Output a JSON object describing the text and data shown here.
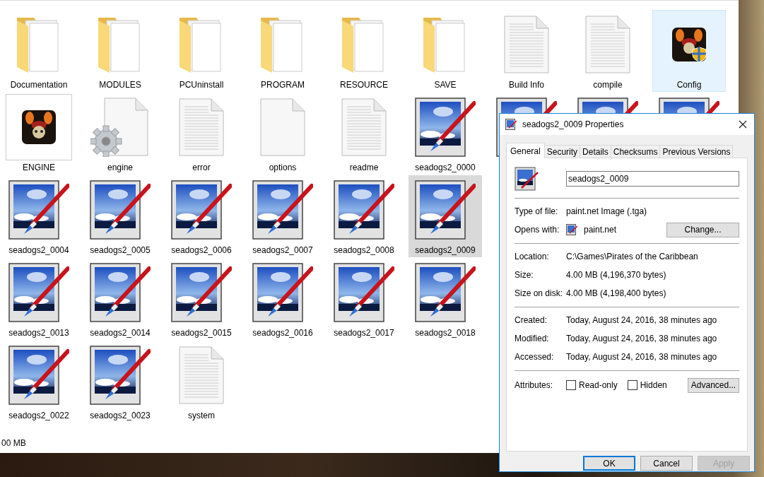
{
  "explorer": {
    "rows": [
      [
        {
          "label": "Documentation",
          "kind": "folder",
          "selected": false,
          "hovered": false
        },
        {
          "label": "MODULES",
          "kind": "folder",
          "selected": false,
          "hovered": false
        },
        {
          "label": "PCUninstall",
          "kind": "folder",
          "selected": false,
          "hovered": false
        },
        {
          "label": "PROGRAM",
          "kind": "folder",
          "selected": false,
          "hovered": false
        },
        {
          "label": "RESOURCE",
          "kind": "folder",
          "selected": false,
          "hovered": false
        },
        {
          "label": "SAVE",
          "kind": "folder",
          "selected": false,
          "hovered": false
        },
        {
          "label": "Build Info",
          "kind": "text",
          "selected": false,
          "hovered": false
        },
        {
          "label": "compile",
          "kind": "text",
          "selected": false,
          "hovered": false
        },
        {
          "label": "Config",
          "kind": "config",
          "selected": false,
          "hovered": true
        }
      ],
      [
        {
          "label": "ENGINE",
          "kind": "app",
          "selected": false,
          "hovered": false
        },
        {
          "label": "engine",
          "kind": "settings",
          "selected": false,
          "hovered": false
        },
        {
          "label": "error",
          "kind": "text",
          "selected": false,
          "hovered": false
        },
        {
          "label": "options",
          "kind": "blank",
          "selected": false,
          "hovered": false
        },
        {
          "label": "readme",
          "kind": "text",
          "selected": false,
          "hovered": false
        },
        {
          "label": "seadogs2_0000",
          "kind": "image",
          "selected": false,
          "hovered": false
        },
        {
          "kind": "image",
          "selected": false,
          "hovered": false
        },
        {
          "kind": "image",
          "selected": false,
          "hovered": false
        },
        {
          "kind": "image",
          "selected": false,
          "hovered": false
        }
      ],
      [
        {
          "label": "seadogs2_0004",
          "kind": "image",
          "selected": false,
          "hovered": false
        },
        {
          "label": "seadogs2_0005",
          "kind": "image",
          "selected": false,
          "hovered": false
        },
        {
          "label": "seadogs2_0006",
          "kind": "image",
          "selected": false,
          "hovered": false
        },
        {
          "label": "seadogs2_0007",
          "kind": "image",
          "selected": false,
          "hovered": false
        },
        {
          "label": "seadogs2_0008",
          "kind": "image",
          "selected": false,
          "hovered": false
        },
        {
          "label": "seadogs2_0009",
          "kind": "image",
          "selected": true,
          "hovered": false
        }
      ],
      [
        {
          "label": "seadogs2_0013",
          "kind": "image",
          "selected": false,
          "hovered": false
        },
        {
          "label": "seadogs2_0014",
          "kind": "image",
          "selected": false,
          "hovered": false
        },
        {
          "label": "seadogs2_0015",
          "kind": "image",
          "selected": false,
          "hovered": false
        },
        {
          "label": "seadogs2_0016",
          "kind": "image",
          "selected": false,
          "hovered": false
        },
        {
          "label": "seadogs2_0017",
          "kind": "image",
          "selected": false,
          "hovered": false
        },
        {
          "label": "seadogs2_0018",
          "kind": "image",
          "selected": false,
          "hovered": false
        }
      ],
      [
        {
          "label": "seadogs2_0022",
          "kind": "image",
          "selected": false,
          "hovered": false
        },
        {
          "label": "seadogs2_0023",
          "kind": "image",
          "selected": false,
          "hovered": false
        },
        {
          "label": "system",
          "kind": "text",
          "selected": false,
          "hovered": false
        }
      ]
    ],
    "status_bar": "00 MB"
  },
  "dialog": {
    "title": "seadogs2_0009 Properties",
    "tabs": [
      {
        "label": "General",
        "selected": true
      },
      {
        "label": "Security",
        "selected": false
      },
      {
        "label": "Details",
        "selected": false
      },
      {
        "label": "Checksums",
        "selected": false
      },
      {
        "label": "Previous Versions",
        "selected": false
      }
    ],
    "file_name": "seadogs2_0009",
    "sections": [
      [
        {
          "label": "Type of file:",
          "value": "paint.net Image (.tga)",
          "kind": "text"
        },
        {
          "label": "Opens with:",
          "value": "paint.net",
          "kind": "app",
          "button": "Change..."
        }
      ],
      [
        {
          "label": "Location:",
          "value": "C:\\Games\\Pirates of the Caribbean",
          "kind": "text"
        },
        {
          "label": "Size:",
          "value": "4.00 MB (4,196,370 bytes)",
          "kind": "text"
        },
        {
          "label": "Size on disk:",
          "value": "4.00 MB (4,198,400 bytes)",
          "kind": "text"
        }
      ],
      [
        {
          "label": "Created:",
          "value": "Today, August 24, 2016, 38 minutes ago",
          "kind": "text"
        },
        {
          "label": "Modified:",
          "value": "Today, August 24, 2016, 38 minutes ago",
          "kind": "text"
        },
        {
          "label": "Accessed:",
          "value": "Today, August 24, 2016, 38 minutes ago",
          "kind": "text"
        }
      ]
    ],
    "attributes": {
      "label": "Attributes:",
      "checkboxes": [
        {
          "label": "Read-only",
          "checked": false
        },
        {
          "label": "Hidden",
          "checked": false
        }
      ],
      "button": "Advanced..."
    },
    "buttons": [
      {
        "label": "OK",
        "focused": true,
        "disabled": false
      },
      {
        "label": "Cancel",
        "focused": false,
        "disabled": false
      },
      {
        "label": "Apply",
        "focused": false,
        "disabled": true
      }
    ]
  }
}
